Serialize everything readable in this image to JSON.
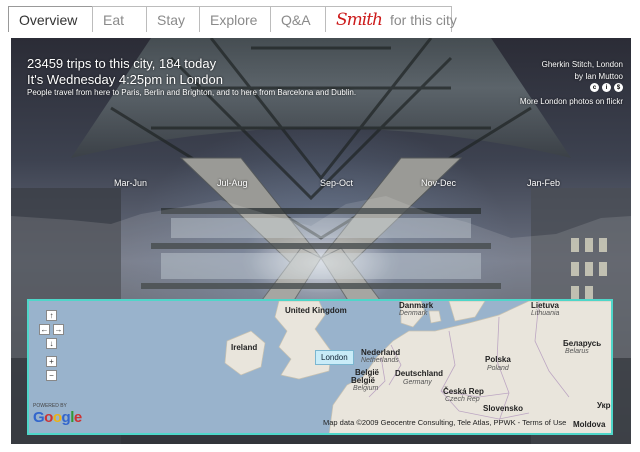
{
  "tabs": [
    {
      "label": "Overview",
      "active": true
    },
    {
      "label": "Eat"
    },
    {
      "label": "Stay"
    },
    {
      "label": "Explore"
    },
    {
      "label": "Q&A"
    },
    {
      "label": "for this city",
      "logo_text": "Smith"
    }
  ],
  "stats": {
    "trips": "23459 trips to this city, 184 today",
    "time": "It's Wednesday 4:25pm in London",
    "people": "People travel from here to Paris, Berlin and Brighton, and to here from Barcelona and Dublin."
  },
  "photo_credit": {
    "title": "Gherkin Stitch, London",
    "author": "by Ian Muttoo",
    "cc_icons": [
      "cc-icon",
      "by-icon",
      "nc-icon"
    ],
    "more_link": "More London photos on flickr"
  },
  "seasons": [
    "Mar-Jun",
    "Jul-Aug",
    "Sep-Oct",
    "Nov-Dec",
    "Jan-Feb"
  ],
  "map": {
    "controls": {
      "up": "↑",
      "left": "←",
      "right": "→",
      "down": "↓",
      "zoom_in": "+",
      "zoom_out": "−"
    },
    "marker": "London",
    "countries": {
      "united_kingdom": "United Kingdom",
      "ireland": "Ireland",
      "denmark": "Danmark",
      "denmark_sub": "Denmark",
      "lietuva": "Lietuva",
      "lietuva_sub": "Lithuania",
      "belarus": "Беларусь",
      "belarus_sub": "Belarus",
      "nederland": "Nederland",
      "nederland_sub": "Netherlands",
      "belgie": "België",
      "belgie_sub": "Belgium",
      "deutschland": "Deutschland",
      "deutschland_sub": "Germany",
      "polska": "Polska",
      "polska_sub": "Poland",
      "ceska": "Česká Rep",
      "ceska_sub": "Czech Rep",
      "slovensko": "Slovensko",
      "ukraine": "Укр",
      "moldova": "Moldova"
    },
    "powered_by": "POWERED BY",
    "google": "Google",
    "attribution": "Map data ©2009 Geocentre Consulting, Tele Atlas, PPWK - Terms of Use"
  },
  "colors": {
    "map_border": "#4fd6c9",
    "sea": "#99b3cc",
    "land": "#e9e5dc",
    "logo_red": "#cc1a1a"
  }
}
